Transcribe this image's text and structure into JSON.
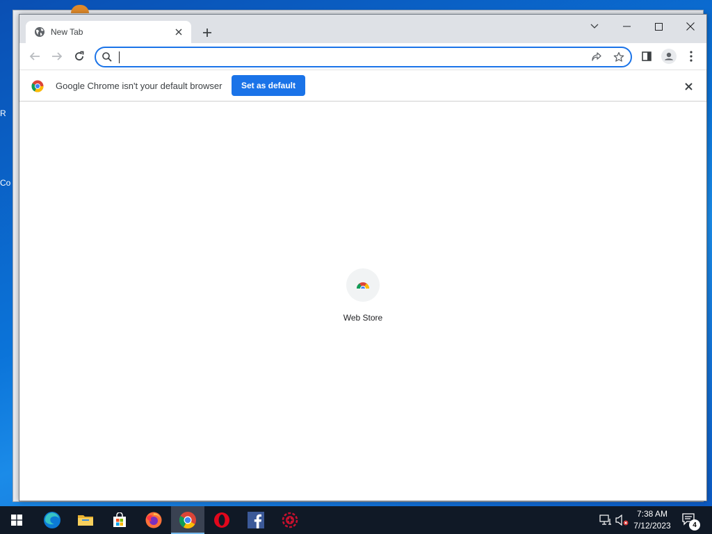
{
  "desktop": {
    "fragments": [
      "R",
      "Co"
    ]
  },
  "browser": {
    "tab": {
      "title": "New Tab",
      "icon": "globe-icon"
    },
    "omnibox": {
      "value": "",
      "placeholder": ""
    },
    "infobar": {
      "message": "Google Chrome isn't your default browser",
      "button_label": "Set as default"
    },
    "shortcuts": [
      {
        "label": "Web Store",
        "icon": "web-store-icon"
      }
    ]
  },
  "taskbar": {
    "apps": [
      {
        "name": "edge",
        "icon": "edge-icon"
      },
      {
        "name": "file-explorer",
        "icon": "folder-icon"
      },
      {
        "name": "microsoft-store",
        "icon": "store-icon"
      },
      {
        "name": "firefox",
        "icon": "firefox-icon"
      },
      {
        "name": "chrome",
        "icon": "chrome-icon",
        "active": true
      },
      {
        "name": "opera",
        "icon": "opera-icon"
      },
      {
        "name": "facebook",
        "icon": "facebook-icon"
      },
      {
        "name": "app",
        "icon": "red-gear-icon"
      }
    ],
    "clock": {
      "time": "7:38 AM",
      "date": "7/12/2023"
    },
    "notification_count": "4"
  },
  "colors": {
    "accent": "#1a73e8",
    "taskbar": "#101926",
    "tabstrip": "#dee1e6"
  }
}
